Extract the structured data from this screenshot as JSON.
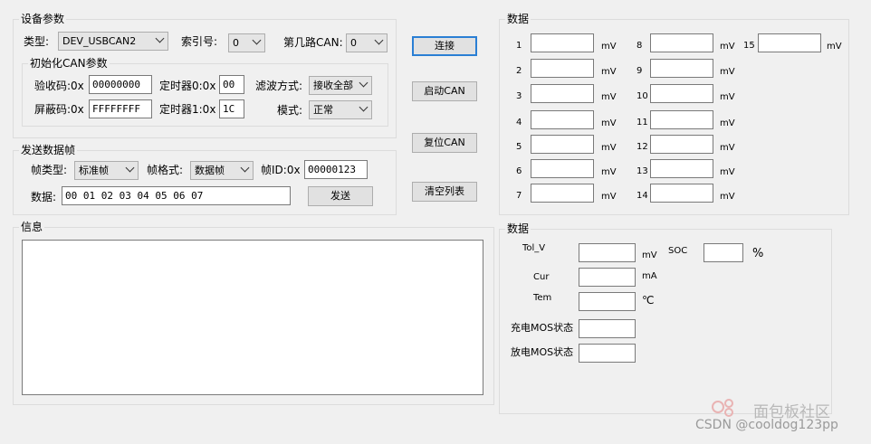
{
  "device_group": {
    "title": "设备参数",
    "type_label": "类型:",
    "type_value": "DEV_USBCAN2",
    "index_label": "索引号:",
    "index_value": "0",
    "channel_label": "第几路CAN:",
    "channel_value": "0"
  },
  "init_group": {
    "title": "初始化CAN参数",
    "acc_code_label": "验收码:0x",
    "acc_code_value": "00000000",
    "timer0_label": "定时器0:0x",
    "timer0_value": "00",
    "filter_label": "滤波方式:",
    "filter_value": "接收全部",
    "mask_label": "屏蔽码:0x",
    "mask_value": "FFFFFFFF",
    "timer1_label": "定时器1:0x",
    "timer1_value": "1C",
    "mode_label": "模式:",
    "mode_value": "正常"
  },
  "send_group": {
    "title": "发送数据帧",
    "frame_type_label": "帧类型:",
    "frame_type_value": "标准帧",
    "frame_format_label": "帧格式:",
    "frame_format_value": "数据帧",
    "frame_id_label": "帧ID:0x",
    "frame_id_value": "00000123",
    "data_label": "数据:",
    "data_value": "00 01 02 03 04 05 06 07",
    "send_button": "发送"
  },
  "buttons": {
    "connect": "连接",
    "start_can": "启动CAN",
    "reset_can": "复位CAN",
    "clear_list": "清空列表"
  },
  "info_group": {
    "title": "信息"
  },
  "cells_group": {
    "title": "数据",
    "unit": "mV",
    "cells": [
      "1",
      "2",
      "3",
      "4",
      "5",
      "6",
      "7",
      "8",
      "9",
      "10",
      "11",
      "12",
      "13",
      "14",
      "15"
    ]
  },
  "bms_group": {
    "title": "数据",
    "tol_v_label": "Tol_V",
    "tol_v_unit": "mV",
    "soc_label": "SOC",
    "soc_unit": "%",
    "cur_label": "Cur",
    "cur_unit": "mA",
    "tem_label": "Tem",
    "tem_unit": "℃",
    "charge_mos_label": "充电MOS状态",
    "discharge_mos_label": "放电MOS状态"
  },
  "watermark": {
    "site": "面包板社区",
    "credit": "CSDN @cooldog123pp"
  }
}
